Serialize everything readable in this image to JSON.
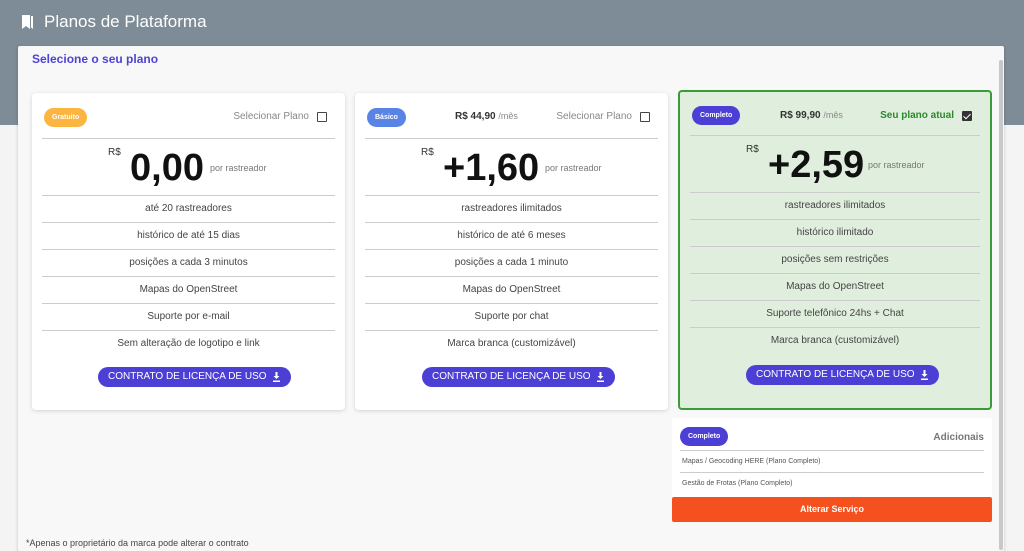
{
  "header": {
    "title": "Planos de Plataforma",
    "icon": "bookmark-icon"
  },
  "panel": {
    "select_label": "Selecione o seu plano"
  },
  "plans": [
    {
      "badge": "Gratuito",
      "price_small": "",
      "price_small_per": "",
      "select_label": "Selecionar Plano",
      "currency": "R$",
      "price": "0,00",
      "per": "por rastreador",
      "features": [
        "até 20 rastreadores",
        "histórico de até 15 dias",
        "posições a cada 3 minutos",
        "Mapas do OpenStreet",
        "Suporte por e-mail",
        "Sem alteração de logotipo e link"
      ],
      "contract_label": "CONTRATO DE LICENÇA DE USO",
      "selected": false
    },
    {
      "badge": "Básico",
      "price_small": "R$ 44,90",
      "price_small_per": "/mês",
      "select_label": "Selecionar Plano",
      "currency": "R$",
      "price": "+1,60",
      "per": "por rastreador",
      "features": [
        "rastreadores ilimitados",
        "histórico de até 6 meses",
        "posições a cada 1 minuto",
        "Mapas do OpenStreet",
        "Suporte por chat",
        "Marca branca (customizável)"
      ],
      "contract_label": "CONTRATO DE LICENÇA DE USO",
      "selected": false
    },
    {
      "badge": "Completo",
      "price_small": "R$ 99,90",
      "price_small_per": "/mês",
      "select_label": "Seu plano atual",
      "currency": "R$",
      "price": "+2,59",
      "per": "por rastreador",
      "features": [
        "rastreadores ilimitados",
        "histórico ilimitado",
        "posições sem restrições",
        "Mapas do OpenStreet",
        "Suporte telefônico 24hs + Chat",
        "Marca branca (customizável)"
      ],
      "contract_label": "CONTRATO DE LICENÇA DE USO",
      "selected": true
    }
  ],
  "addons": {
    "badge": "Completo",
    "label": "Adicionais",
    "items": [
      "Mapas / Geocoding HERE (Plano Completo)",
      "Gestão de Frotas (Plano Completo)"
    ]
  },
  "alter_button": "Alterar Serviço",
  "footnote": "*Apenas o proprietário da marca pode alterar o contrato",
  "colors": {
    "accent": "#4b3fd6",
    "current_border": "#3b9b3b",
    "current_bg": "#e0eedd",
    "alter": "#f4511e",
    "gratuito": "#fbb540",
    "basico": "#5a83e6"
  }
}
